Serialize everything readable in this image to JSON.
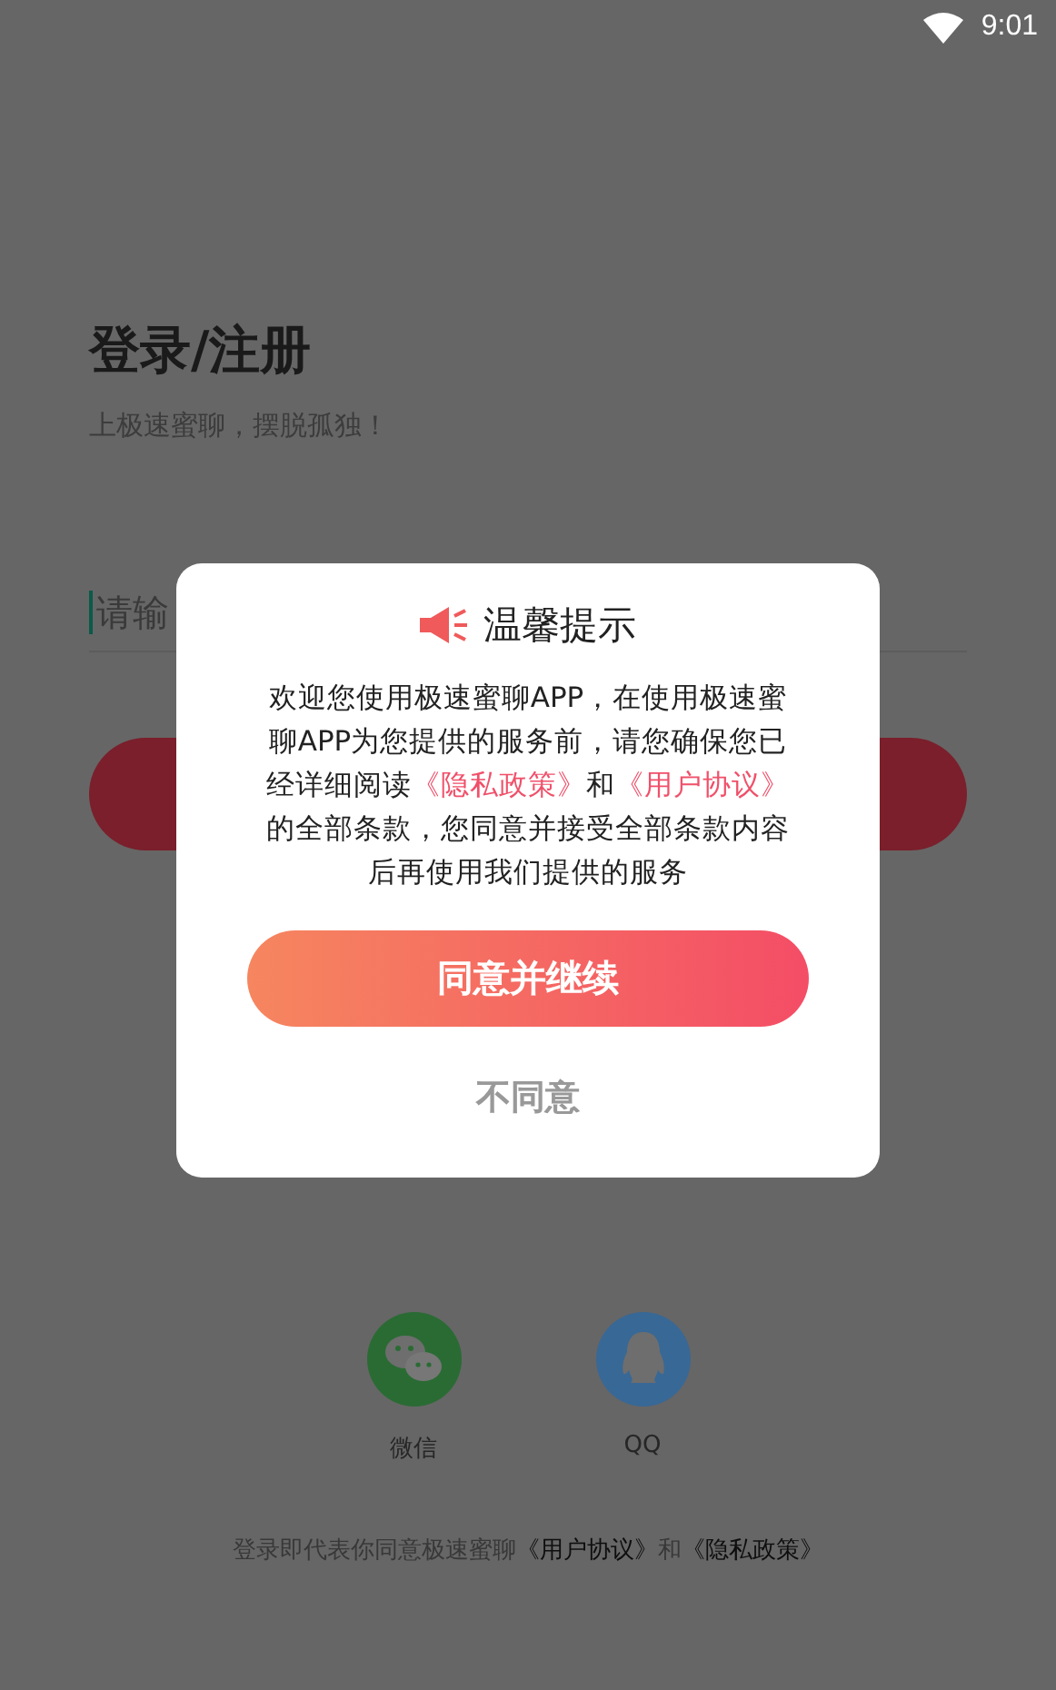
{
  "status_bar": {
    "time": "9:01"
  },
  "login": {
    "title": "登录/注册",
    "subtitle": "上极速蜜聊，摆脱孤独！",
    "phone_field": {
      "placeholder": "请输"
    },
    "social": [
      {
        "kind": "wechat",
        "label": "微信"
      },
      {
        "kind": "qq",
        "label": "QQ"
      }
    ],
    "footer": [
      {
        "kind": "text",
        "text": "登录即代表你同意极速蜜聊"
      },
      {
        "kind": "link",
        "text": "《用户协议》"
      },
      {
        "kind": "text",
        "text": "和"
      },
      {
        "kind": "link",
        "text": "《隐私政策》"
      }
    ]
  },
  "dialog": {
    "title": "温馨提示",
    "message": [
      {
        "kind": "text",
        "text": "欢迎您使用极速蜜聊APP，在使用极速蜜聊APP为您提供的服务前，请您确保您已经详细阅读"
      },
      {
        "kind": "link",
        "text": "《隐私政策》"
      },
      {
        "kind": "text",
        "text": "和"
      },
      {
        "kind": "link",
        "text": "《用户协议》"
      },
      {
        "kind": "text",
        "text": "的全部条款，您同意并接受全部条款内容后再使用我们提供的服务"
      }
    ],
    "buttons": [
      {
        "kind": "primary",
        "label": "同意并继续"
      },
      {
        "kind": "secondary",
        "label": "不同意"
      }
    ]
  }
}
